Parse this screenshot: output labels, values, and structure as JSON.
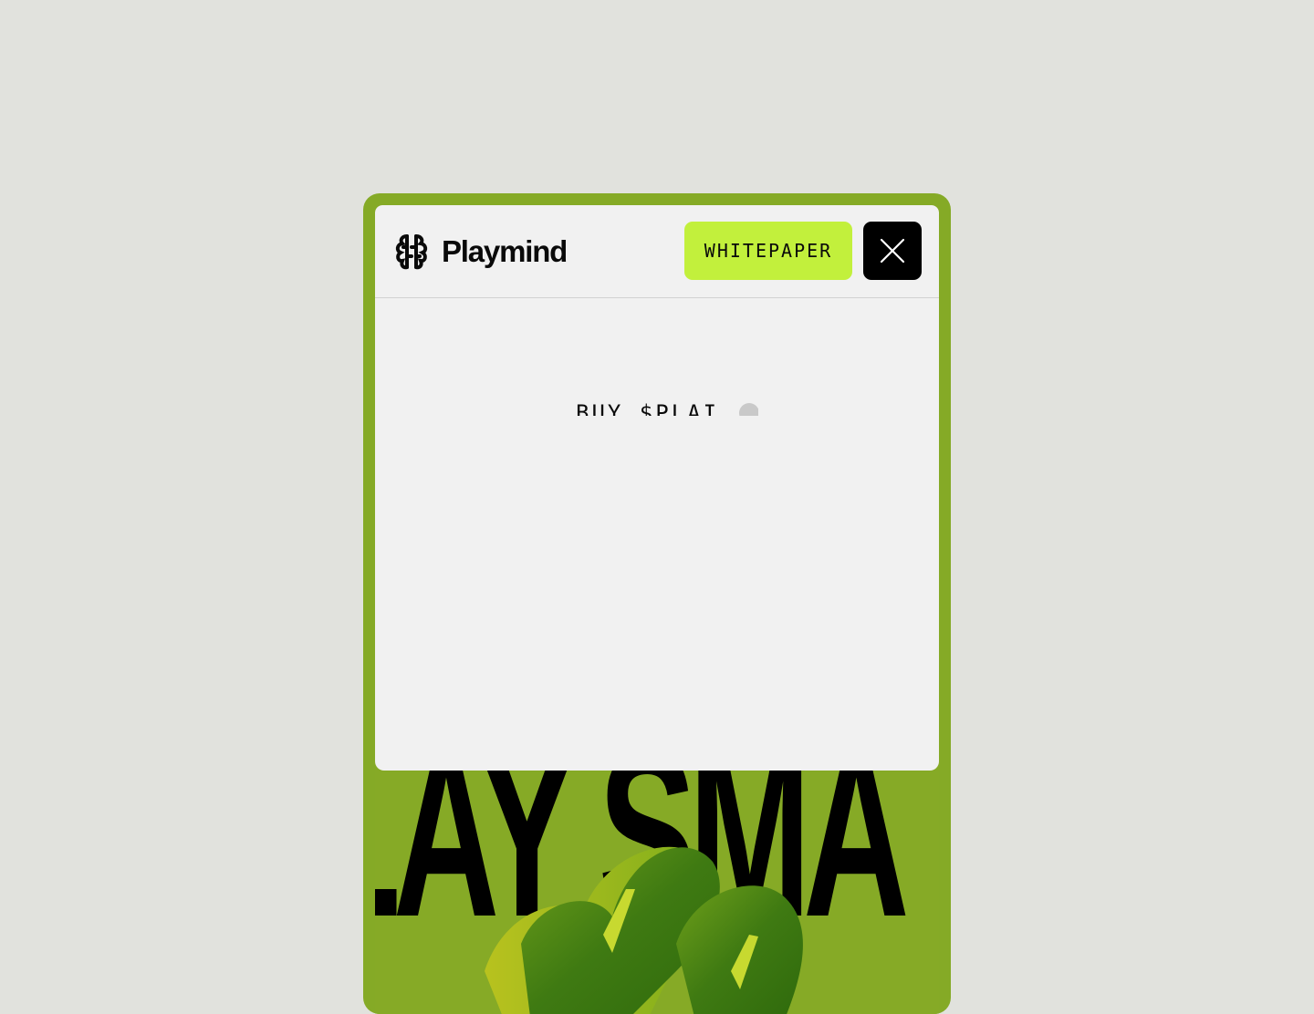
{
  "brand": {
    "name": "Playmind",
    "logo_icon": "brain-icon"
  },
  "header": {
    "whitepaper_label": "WHITEPAPER",
    "close_icon": "close-icon"
  },
  "menu": {
    "buy_item_label": "BUY $PLAI"
  },
  "hero": {
    "headline": "LAY SMA"
  },
  "colors": {
    "page_background": "#e1e2dd",
    "device_frame": "#85aa26",
    "sheet_background": "#f1f1f1",
    "accent_lime": "#c2f03c",
    "close_button": "#000000"
  }
}
